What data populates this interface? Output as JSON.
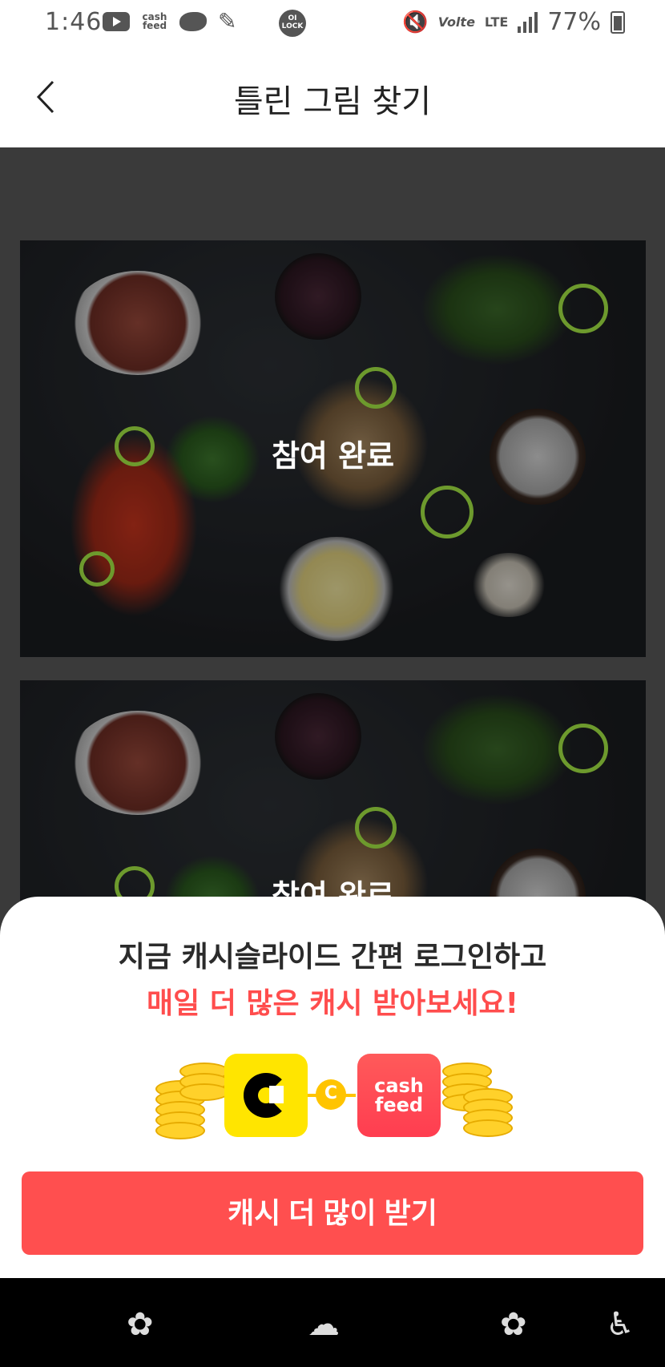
{
  "status_bar": {
    "time": "1:46",
    "cashfeed_mini_top": "cash",
    "cashfeed_mini_bottom": "feed",
    "lock_badge_top": "OI",
    "lock_badge_bottom": "LOCK",
    "volte": "Volte",
    "lte": "LTE",
    "battery_text": "77%"
  },
  "header": {
    "title": "틀린 그림 찾기"
  },
  "cards": [
    {
      "status": "참여 완료"
    },
    {
      "status": "참여 완료"
    }
  ],
  "sheet": {
    "line1": "지금 캐시슬라이드 간편 로그인하고",
    "line2": "매일 더 많은 캐시 받아보세요!",
    "link_symbol": "C",
    "cashfeed_logo_top": "cash",
    "cashfeed_logo_bottom": "feed",
    "cta": "캐시 더 많이 받기",
    "colors": {
      "accent_red": "#ff4f4f",
      "coin_yellow": "#ffd12a",
      "cashslide_yellow": "#ffe500"
    }
  },
  "nav_bar": {
    "icons": [
      "flower-icon",
      "rainbow-cloud-icon",
      "flower-icon",
      "accessibility-icon"
    ]
  },
  "marker_color": "#6d9a2d"
}
